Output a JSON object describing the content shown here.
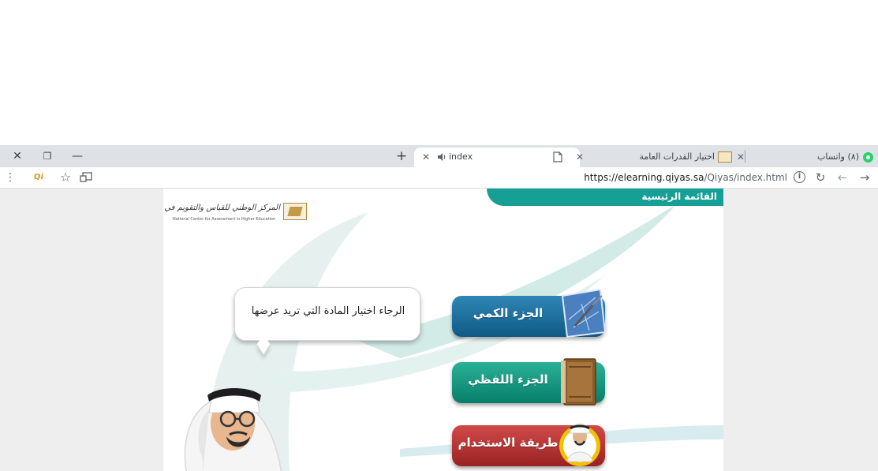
{
  "window_controls": {
    "close": "✕",
    "restore": "❐",
    "minimize": "—"
  },
  "tabs": [
    {
      "title": "index",
      "close": "✕",
      "audio_icon": "speaker-icon",
      "active": true
    },
    {
      "title": "اختيار القدرات العامة",
      "close": "✕",
      "active": false
    },
    {
      "title": "(٨) واتساب",
      "active": false
    }
  ],
  "new_tab": "+",
  "toolbar": {
    "menu_icon": "⋮",
    "extension_label": "Qi",
    "star_icon": "☆",
    "url_domain": "https://elearning.qiyas.sa",
    "url_path": "/Qiyas/index.html",
    "info_icon": "i",
    "reload_icon": "↻",
    "back_icon": "←",
    "forward_icon": "→"
  },
  "page": {
    "menu_title": "القائمة الرئيسية",
    "logo_ar": "المركز الوطني للقياس والتقويم في التعليم العالي",
    "logo_en": "National Center for Assessment in Higher Education",
    "bubble_text": "الرجاء اختيار المادة التي تريد عرضها",
    "buttons": {
      "quantitative": "الجزء الكمي",
      "verbal": "الجزء اللفظي",
      "usage": "طريقة الاستخدام"
    }
  },
  "colors": {
    "teal": "#159f95",
    "blue_btn": "#1a6b97",
    "green_btn": "#128b76",
    "red_btn": "#b33535",
    "tab_strip": "#dee1e6"
  }
}
